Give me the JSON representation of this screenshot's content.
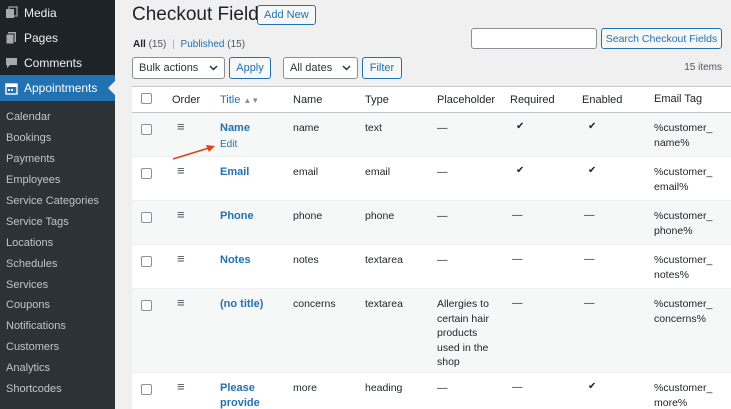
{
  "sidebar": {
    "top_items": [
      {
        "label": "Media",
        "icon": "media-icon"
      },
      {
        "label": "Pages",
        "icon": "pages-icon"
      },
      {
        "label": "Comments",
        "icon": "comments-icon"
      },
      {
        "label": "Appointments",
        "icon": "calendar-icon",
        "active": true
      }
    ],
    "sub_items": [
      "Calendar",
      "Bookings",
      "Payments",
      "Employees",
      "Service Categories",
      "Service Tags",
      "Locations",
      "Schedules",
      "Services",
      "Coupons",
      "Notifications",
      "Customers",
      "Analytics",
      "Shortcodes"
    ]
  },
  "header": {
    "title": "Checkout Fields",
    "add_new": "Add New",
    "filter_all": "All",
    "filter_all_count": "(15)",
    "filter_sep": "|",
    "filter_published": "Published",
    "filter_published_count": "(15)",
    "search_button": "Search Checkout Fields",
    "search_value": ""
  },
  "toolbar": {
    "bulk_actions": "Bulk actions",
    "apply": "Apply",
    "all_dates": "All dates",
    "filter": "Filter",
    "items_count": "15 items"
  },
  "table": {
    "columns": {
      "order": "Order",
      "title": "Title",
      "name": "Name",
      "type": "Type",
      "placeholder": "Placeholder",
      "required": "Required",
      "enabled": "Enabled",
      "email_tag": "Email Tag"
    },
    "rows": [
      {
        "title": "Name",
        "action": "Edit",
        "name": "name",
        "type": "text",
        "placeholder": "—",
        "required": "✔",
        "enabled": "✔",
        "tag1": "%customer_",
        "tag2": "name%"
      },
      {
        "title": "Email",
        "name": "email",
        "type": "email",
        "placeholder": "—",
        "required": "✔",
        "enabled": "✔",
        "tag1": "%customer_",
        "tag2": "email%"
      },
      {
        "title": "Phone",
        "name": "phone",
        "type": "phone",
        "placeholder": "—",
        "required": "—",
        "enabled": "—",
        "tag1": "%customer_",
        "tag2": "phone%"
      },
      {
        "title": "Notes",
        "name": "notes",
        "type": "textarea",
        "placeholder": "—",
        "required": "—",
        "enabled": "—",
        "tag1": "%customer_",
        "tag2": "notes%"
      },
      {
        "title": "(no title)",
        "name": "concerns",
        "type": "textarea",
        "placeholder_lines": [
          "Allergies to",
          "certain hair",
          "products",
          "used in the",
          "shop"
        ],
        "required": "—",
        "enabled": "—",
        "tag1": "%customer_",
        "tag2": "concerns%"
      },
      {
        "title1": "Please",
        "title2": "provide",
        "name": "more",
        "type": "heading",
        "placeholder": "—",
        "required": "—",
        "enabled": "✔",
        "tag1": "%customer_",
        "tag2": "more%"
      }
    ]
  },
  "colors": {
    "accent": "#2271b1",
    "sidebar": "#1d2327",
    "annotation_arrow": "#e2401c"
  }
}
